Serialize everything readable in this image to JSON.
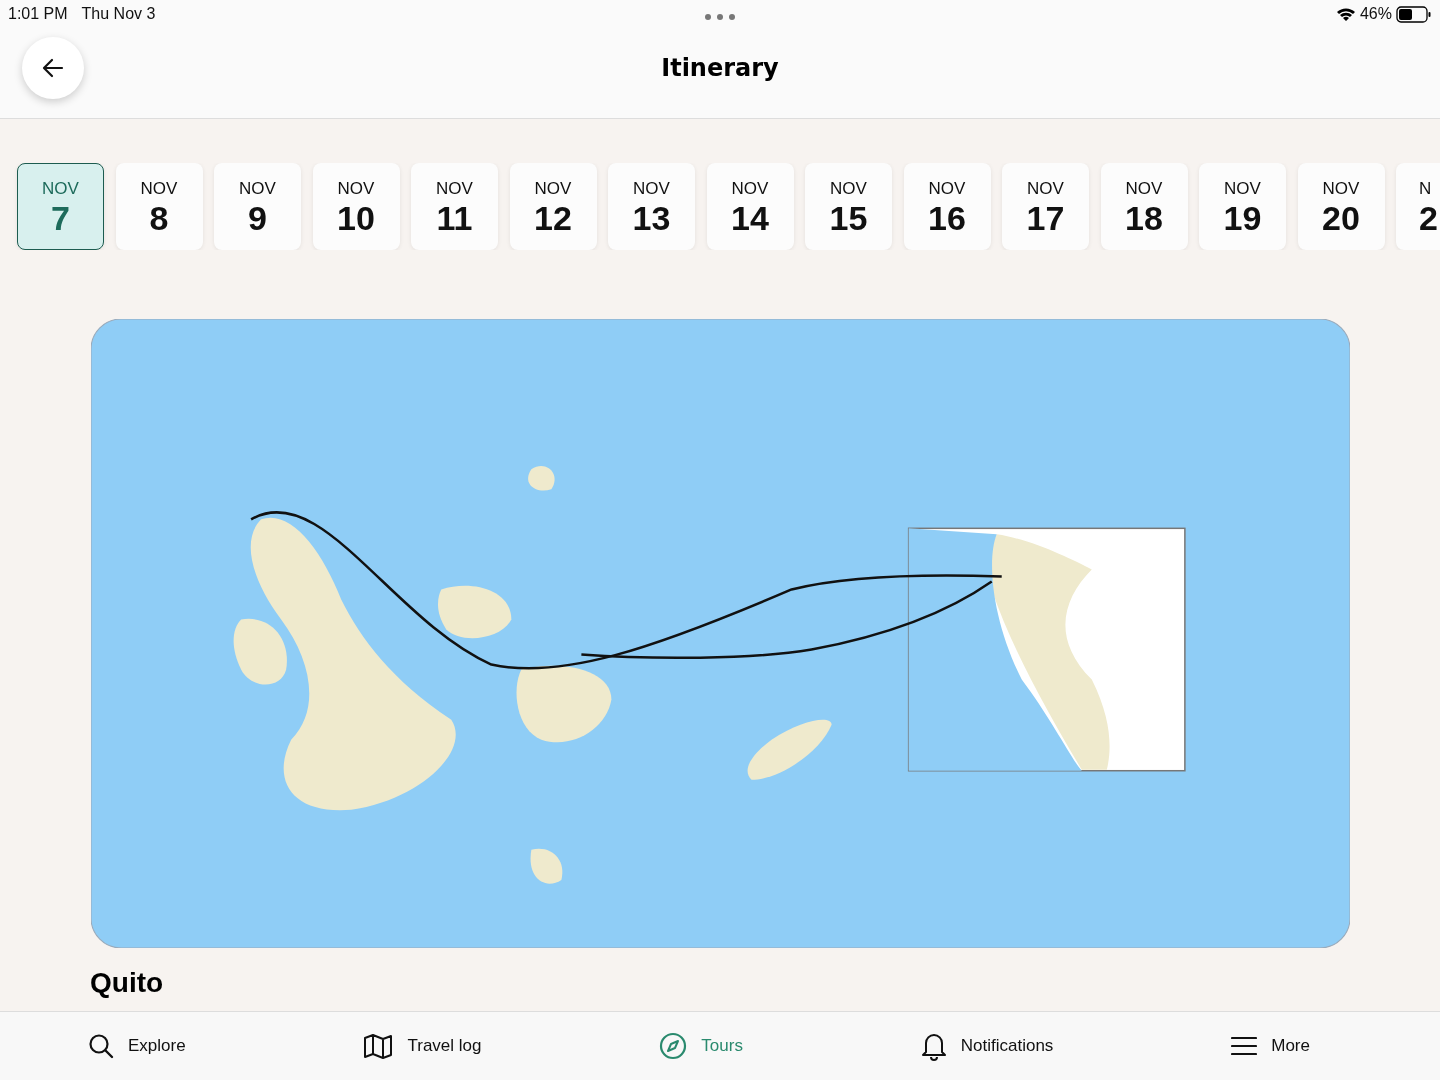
{
  "status_bar": {
    "time": "1:01 PM",
    "date": "Thu Nov 3",
    "battery": "46%"
  },
  "header": {
    "title": "Itinerary"
  },
  "dates": [
    {
      "month": "NOV",
      "day": "7",
      "selected": true
    },
    {
      "month": "NOV",
      "day": "8",
      "selected": false
    },
    {
      "month": "NOV",
      "day": "9",
      "selected": false
    },
    {
      "month": "NOV",
      "day": "10",
      "selected": false
    },
    {
      "month": "NOV",
      "day": "11",
      "selected": false
    },
    {
      "month": "NOV",
      "day": "12",
      "selected": false
    },
    {
      "month": "NOV",
      "day": "13",
      "selected": false
    },
    {
      "month": "NOV",
      "day": "14",
      "selected": false
    },
    {
      "month": "NOV",
      "day": "15",
      "selected": false
    },
    {
      "month": "NOV",
      "day": "16",
      "selected": false
    },
    {
      "month": "NOV",
      "day": "17",
      "selected": false
    },
    {
      "month": "NOV",
      "day": "18",
      "selected": false
    },
    {
      "month": "NOV",
      "day": "19",
      "selected": false
    },
    {
      "month": "NOV",
      "day": "20",
      "selected": false
    },
    {
      "month": "N",
      "day": "2",
      "selected": false
    }
  ],
  "section": {
    "title": "Quito"
  },
  "tab_bar": [
    {
      "label": "Explore",
      "kind": "search",
      "selected": false
    },
    {
      "label": "Travel log",
      "kind": "map",
      "selected": false
    },
    {
      "label": "Tours",
      "kind": "compass",
      "selected": true
    },
    {
      "label": "Notifications",
      "kind": "bell",
      "selected": false
    },
    {
      "label": "More",
      "kind": "menu",
      "selected": false
    }
  ]
}
